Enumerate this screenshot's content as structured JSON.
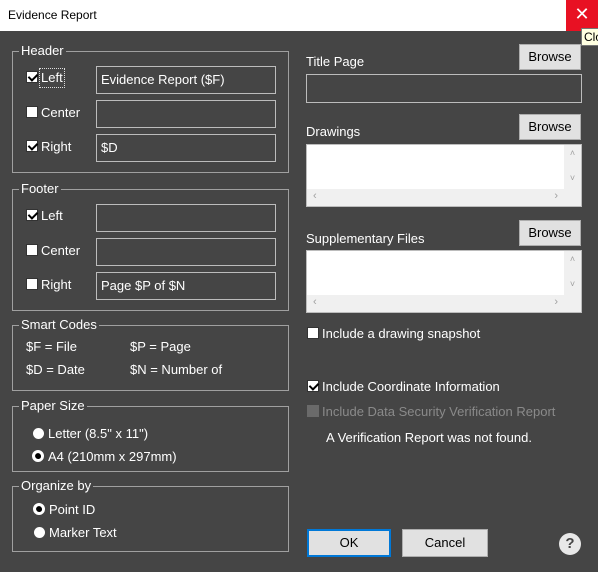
{
  "window": {
    "title": "Evidence Report",
    "close_icon": "✕",
    "tooltip": "Clo"
  },
  "header": {
    "legend": "Header",
    "left": {
      "label": "Left",
      "checked": true,
      "value": "Evidence Report ($F)"
    },
    "center": {
      "label": "Center",
      "checked": false,
      "value": ""
    },
    "right": {
      "label": "Right",
      "checked": true,
      "value": "$D"
    }
  },
  "footer": {
    "legend": "Footer",
    "left": {
      "label": "Left",
      "checked": true,
      "value": ""
    },
    "center": {
      "label": "Center",
      "checked": false,
      "value": ""
    },
    "right": {
      "label": "Right",
      "checked": false,
      "value": "Page $P of $N"
    }
  },
  "smart_codes": {
    "legend": "Smart Codes",
    "items": [
      "$F = File",
      "$P = Page",
      "$D = Date",
      "$N = Number of"
    ]
  },
  "paper_size": {
    "legend": "Paper Size",
    "options": [
      "Letter (8.5\" x 11\")",
      "A4 (210mm x 297mm)"
    ],
    "selected": "A4 (210mm x 297mm)"
  },
  "organize_by": {
    "legend": "Organize by",
    "options": [
      "Point ID",
      "Marker Text"
    ],
    "selected": "Point ID"
  },
  "title_page": {
    "label": "Title Page",
    "browse": "Browse",
    "value": ""
  },
  "drawings": {
    "label": "Drawings",
    "browse": "Browse"
  },
  "supplementary": {
    "label": "Supplementary Files",
    "browse": "Browse"
  },
  "scroll_icons": {
    "up": "˄",
    "down": "˅",
    "left": "‹",
    "right": "›"
  },
  "options": {
    "snapshot": {
      "label": "Include a drawing snapshot",
      "checked": false
    },
    "coordinates": {
      "label": "Include Coordinate Information",
      "checked": true
    },
    "security": {
      "label": "Include Data Security Verification Report",
      "checked": false,
      "enabled": false
    }
  },
  "verification_message": "A Verification Report was not found.",
  "buttons": {
    "ok": "OK",
    "cancel": "Cancel",
    "help": "?"
  }
}
